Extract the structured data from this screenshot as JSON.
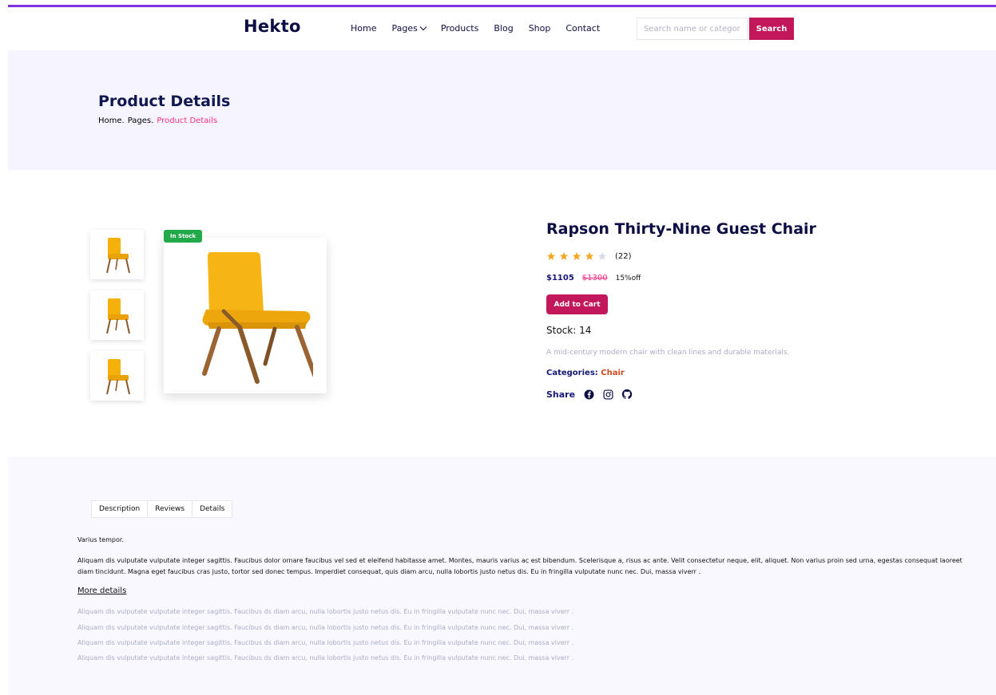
{
  "header": {
    "logo": "Hekto",
    "nav": [
      "Home",
      "Pages",
      "Products",
      "Blog",
      "Shop",
      "Contact"
    ],
    "search_placeholder": "Search name or category",
    "search_button": "Search"
  },
  "hero": {
    "title": "Product Details",
    "breadcrumb": [
      "Home.",
      "Pages.",
      "Product Details"
    ]
  },
  "product": {
    "badge": "In Stock",
    "title": "Rapson Thirty-Nine Guest Chair",
    "rating": 4,
    "rating_count": "(22)",
    "price": "$1105",
    "old_price": "$1300",
    "discount": "15%off",
    "add_to_cart": "Add to Cart",
    "stock": "Stock: 14",
    "description": "A mid-century modern chair with clean lines and durable materials.",
    "categories_label": "Categories:",
    "category": "Chair",
    "share_label": "Share",
    "share_icons": [
      "facebook-icon",
      "instagram-icon",
      "github-icon"
    ]
  },
  "details": {
    "tabs": [
      "Description",
      "Reviews",
      "Details"
    ],
    "heading": "Varius tempor.",
    "paragraph": "Aliquam dis vulputate vulputate integer sagittis. Faucibus dolor ornare faucibus vel sed et eleifend habitasse amet. Montes, mauris varius ac est bibendum. Scelerisque a, risus ac ante. Velit consectetur neque, elit, aliquet. Non varius proin sed urna, egestas consequat laoreet diam tincidunt. Magna eget faucibus cras justo, tortor sed donec tempus. Imperdiet consequat, quis diam arcu, nulla lobortis justo netus dis. Eu in fringilla vulputate nunc nec. Dui, massa viverr .",
    "more_link": "More details",
    "lines": [
      "Aliquam dis vulputate vulputate integer sagittis. Faucibus ds diam arcu, nulla lobortis justo netus dis. Eu in fringilla vulputate nunc nec. Dui, massa viverr .",
      "Aliquam dis vulputate vulputate integer sagittis. Faucibus ds diam arcu, nulla lobortis justo netus dis. Eu in fringilla vulputate nunc nec. Dui, massa viverr .",
      "Aliquam dis vulputate vulputate integer sagittis. Faucibus ds diam arcu, nulla lobortis justo netus dis. Eu in fringilla vulputate nunc nec. Dui, massa viverr .",
      "Aliquam dis vulputate vulputate integer sagittis. Faucibus ds diam arcu, nulla lobortis justo netus dis. Eu in fringilla vulputate nunc nec. Dui, massa viverr ."
    ]
  },
  "colors": {
    "accent": "#c2185b",
    "pink": "#fb2e86",
    "navy": "#151875",
    "badge_green": "#22a94a",
    "star": "#f5a623"
  }
}
